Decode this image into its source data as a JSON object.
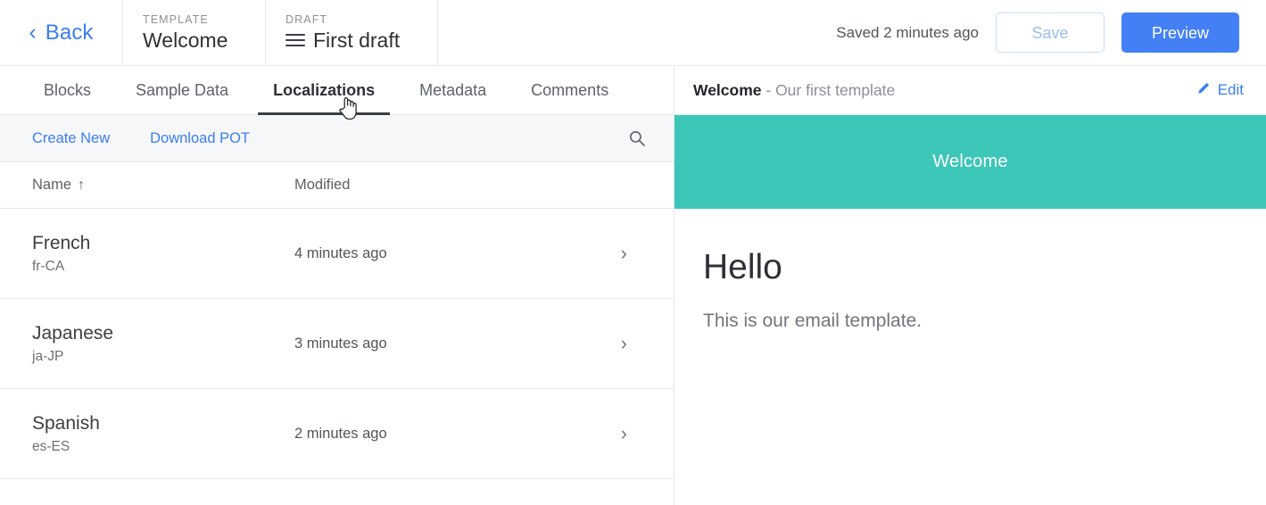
{
  "header": {
    "back_label": "Back",
    "back_icon": "chevron-left-icon",
    "template_eyebrow": "TEMPLATE",
    "template_name": "Welcome",
    "draft_eyebrow": "DRAFT",
    "draft_name": "First draft",
    "draft_icon": "hamburger-menu-icon",
    "saved_status": "Saved 2 minutes ago",
    "save_label": "Save",
    "preview_label": "Preview",
    "accent_blue": "#4380f5",
    "link_blue": "#3b7ef2"
  },
  "tabs": [
    {
      "label": "Blocks",
      "active": false
    },
    {
      "label": "Sample Data",
      "active": false
    },
    {
      "label": "Localizations",
      "active": true
    },
    {
      "label": "Metadata",
      "active": false
    },
    {
      "label": "Comments",
      "active": false
    }
  ],
  "list_toolbar": {
    "create_new": "Create New",
    "download_pot": "Download POT",
    "search_icon": "search-icon"
  },
  "table": {
    "columns": [
      {
        "label": "Name",
        "sort_arrow": "↑"
      },
      {
        "label": "Modified",
        "sort_arrow": ""
      }
    ],
    "rows": [
      {
        "name": "French",
        "code": "fr-CA",
        "modified": "4 minutes ago",
        "chevron": "›"
      },
      {
        "name": "Japanese",
        "code": "ja-JP",
        "modified": "3 minutes ago",
        "chevron": "›"
      },
      {
        "name": "Spanish",
        "code": "es-ES",
        "modified": "2 minutes ago",
        "chevron": "›"
      }
    ]
  },
  "preview": {
    "title_bold": "Welcome",
    "title_rest": " - Our first template",
    "edit_label": "Edit",
    "edit_icon": "pencil-icon",
    "banner_text": "Welcome",
    "banner_color": "#3cc6b7",
    "heading": "Hello",
    "paragraph": "This is our email template."
  },
  "cursor": {
    "icon": "pointer-hand-cursor"
  }
}
